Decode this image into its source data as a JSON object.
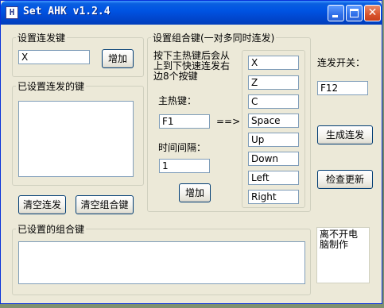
{
  "window": {
    "app_icon": "H",
    "title": "Set AHK v1.2.4",
    "minimize_icon": "minimize-icon",
    "maximize_icon": "maximize-icon",
    "close_icon": "close-icon",
    "close_glyph": "✕"
  },
  "hotkey_group": {
    "legend": "设置连发键",
    "input_value": "X",
    "add_label": "增加"
  },
  "set_keys_group": {
    "legend": "已设置连发的键"
  },
  "combo_group": {
    "legend": "设置组合键(一对多同时连发)",
    "hint": "按下主热键后会从上到下快速连发右边8个按键",
    "main_hotkey_label": "主热键：",
    "main_hotkey_value": "F1",
    "arrow": "==>",
    "interval_label": "时间间隔：",
    "interval_value": "1",
    "add_label": "增加",
    "keys": [
      "X",
      "Z",
      "C",
      "Space",
      "Up",
      "Down",
      "Left",
      "Right"
    ]
  },
  "toggle": {
    "label": "连发开关：",
    "value": "F12"
  },
  "buttons": {
    "generate": "生成连发",
    "check_update": "检查更新",
    "clear_repeat": "清空连发",
    "clear_combo": "清空组合键"
  },
  "combo_list_group": {
    "legend": "已设置的组合键"
  },
  "credit": {
    "text": "离不开电脑制作"
  }
}
